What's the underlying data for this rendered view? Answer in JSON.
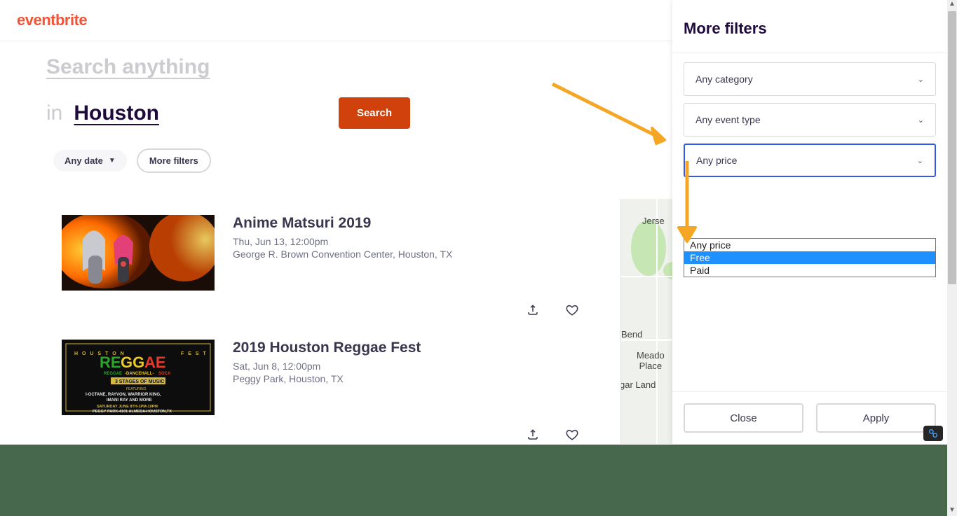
{
  "brand": {
    "logo": "eventbrite"
  },
  "search": {
    "placeholder": "Search anything",
    "in_label": "in",
    "location": "Houston",
    "button": "Search"
  },
  "filter_pills": {
    "date": "Any date",
    "more": "More filters"
  },
  "events": [
    {
      "title": "Anime Matsuri 2019",
      "date": "Thu, Jun 13, 12:00pm",
      "venue": "George R. Brown Convention Center, Houston, TX"
    },
    {
      "title": "2019 Houston Reggae Fest",
      "date": "Sat, Jun 8, 12:00pm",
      "venue": "Peggy Park, Houston, TX"
    }
  ],
  "filters_panel": {
    "title": "More filters",
    "category": "Any category",
    "event_type": "Any event type",
    "price": "Any price",
    "price_options": [
      "Any price",
      "Free",
      "Paid"
    ],
    "price_highlighted": "Free",
    "close": "Close",
    "apply": "Apply"
  },
  "map_labels": {
    "jersey": "Jerse",
    "bend": "Bend",
    "meadows": "Meado\nPlace",
    "sugar": "gar Land"
  }
}
